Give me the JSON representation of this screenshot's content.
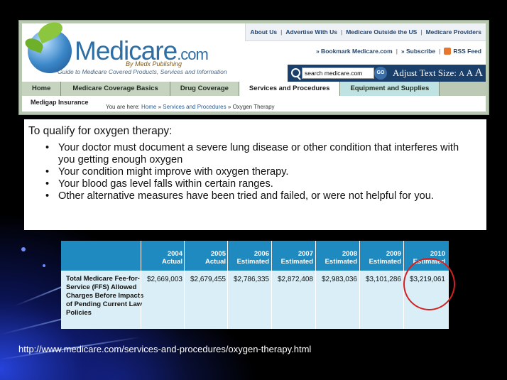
{
  "site": {
    "brand": "Medicare",
    "brand_suffix": ".com",
    "byline": "By Medx Publishing",
    "tagline": "Guide to Medicare Covered Products, Services and Information",
    "top_links": [
      "About Us",
      "Advertise With Us",
      "Medicare Outside the US",
      "Medicare Providers"
    ],
    "mid_links": [
      "» Bookmark Medicare.com",
      "» Subscribe",
      "RSS Feed"
    ],
    "search_value": "search medicare.com",
    "go_label": "GO",
    "adjust_label": "Adjust Text Size:",
    "size_options": [
      "A",
      "A",
      "A"
    ],
    "nav_tabs": [
      "Home",
      "Medicare Coverage Basics",
      "Drug Coverage",
      "Services and Procedures",
      "Equipment and Supplies"
    ],
    "subnav_item": "Medigap Insurance",
    "breadcrumb_prefix": "You are here:",
    "breadcrumb": [
      "Home",
      "Services and Procedures",
      "Oxygen Therapy"
    ],
    "breadcrumb_sep": "»"
  },
  "criteria": {
    "heading": "To qualify for oxygen therapy:",
    "items": [
      "Your doctor must document a severe lung disease or other condition that interferes with you getting enough oxygen",
      "Your condition might improve with oxygen therapy.",
      "Your blood gas level falls within certain ranges.",
      "Other alternative measures have been tried and failed, or were not helpful for you."
    ]
  },
  "table": {
    "columns": [
      {
        "year": "2004",
        "kind": "Actual"
      },
      {
        "year": "2005",
        "kind": "Actual"
      },
      {
        "year": "2006",
        "kind": "Estimated"
      },
      {
        "year": "2007",
        "kind": "Estimated"
      },
      {
        "year": "2008",
        "kind": "Estimated"
      },
      {
        "year": "2009",
        "kind": "Estimated"
      },
      {
        "year": "2010",
        "kind": "Estimated"
      }
    ],
    "row_label": "Total Medicare Fee-for-Service (FFS) Allowed Charges Before Impacts of Pending Current Law Policies",
    "values": [
      "$2,669,003",
      "$2,679,455",
      "$2,786,335",
      "$2,872,408",
      "$2,983,036",
      "$3,101,286",
      "$3,219,061"
    ],
    "highlight_color": "#d42020"
  },
  "source_url": "http://www.medicare.com/services-and-procedures/oxygen-therapy.html"
}
